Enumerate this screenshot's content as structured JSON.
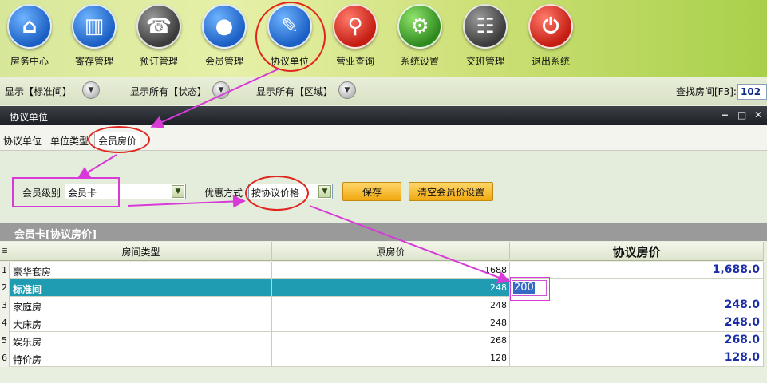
{
  "toolbar": {
    "items": [
      {
        "label": "房务中心",
        "icon": "house-icon"
      },
      {
        "label": "寄存管理",
        "icon": "bag-icon"
      },
      {
        "label": "预订管理",
        "icon": "phone-icon"
      },
      {
        "label": "会员管理",
        "icon": "person-icon"
      },
      {
        "label": "协议单位",
        "icon": "contract-icon"
      },
      {
        "label": "营业查询",
        "icon": "magnifier-icon"
      },
      {
        "label": "系统设置",
        "icon": "gear-icon"
      },
      {
        "label": "交班管理",
        "icon": "group-icon"
      },
      {
        "label": "退出系统",
        "icon": "power-icon"
      }
    ]
  },
  "filterbar": {
    "show_type": "显示【标准间】",
    "show_status": "显示所有【状态】",
    "show_area": "显示所有【区域】",
    "search_label": "查找房间[F3]:",
    "search_value": "102"
  },
  "window": {
    "title": "协议单位"
  },
  "tabs": [
    {
      "label": "协议单位"
    },
    {
      "label": "单位类型"
    },
    {
      "label": "会员房价"
    }
  ],
  "form": {
    "level_label": "会员级别",
    "level_value": "会员卡",
    "discount_label": "优惠方式",
    "discount_value": "按协议价格",
    "save_label": "保存",
    "clear_label": "清空会员价设置"
  },
  "grid": {
    "caption": "会员卡[协议房价]",
    "headers": {
      "type": "房间类型",
      "orig": "原房价",
      "agree": "协议房价"
    },
    "rows": [
      {
        "no": "1",
        "type": "豪华套房",
        "orig": "1688",
        "agree": "1,688.0"
      },
      {
        "no": "2",
        "type": "标准间",
        "orig": "248",
        "agree": "200"
      },
      {
        "no": "3",
        "type": "家庭房",
        "orig": "248",
        "agree": "248.0"
      },
      {
        "no": "4",
        "type": "大床房",
        "orig": "248",
        "agree": "248.0"
      },
      {
        "no": "5",
        "type": "娱乐房",
        "orig": "268",
        "agree": "268.0"
      },
      {
        "no": "6",
        "type": "特价房",
        "orig": "128",
        "agree": "128.0"
      }
    ]
  },
  "colors": {
    "accent_teal": "#1f9cb2",
    "annotation_red": "#e0261f",
    "annotation_magenta": "#d83ad8",
    "price_blue": "#1a2ea8"
  }
}
